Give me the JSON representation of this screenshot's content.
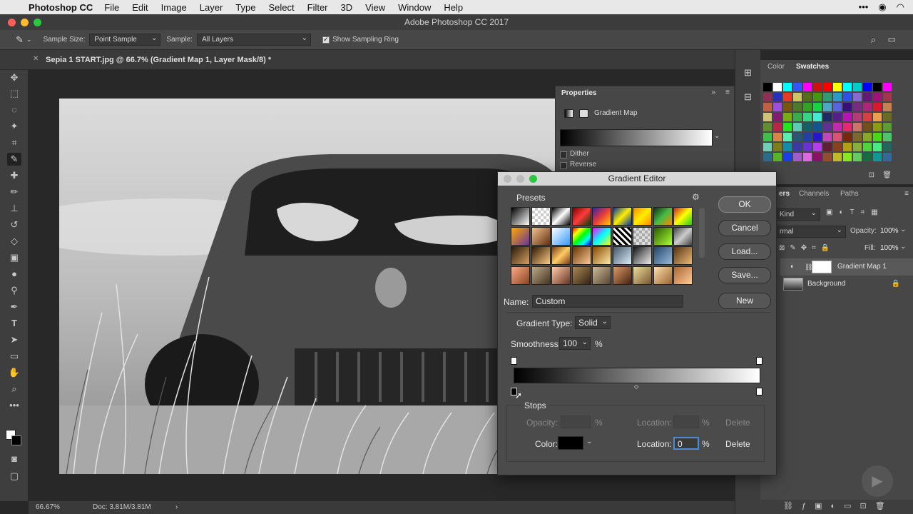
{
  "menubar": {
    "app": "Photoshop CC",
    "items": [
      "File",
      "Edit",
      "Image",
      "Layer",
      "Type",
      "Select",
      "Filter",
      "3D",
      "View",
      "Window",
      "Help"
    ]
  },
  "window": {
    "title": "Adobe Photoshop CC 2017"
  },
  "options": {
    "sample_size_label": "Sample Size:",
    "sample_size_value": "Point Sample",
    "sample_label": "Sample:",
    "sample_value": "All Layers",
    "show_ring_label": "Show Sampling Ring",
    "show_ring_checked": true
  },
  "tab": {
    "title": "Sepia 1 START.jpg @ 66.7% (Gradient Map 1, Layer Mask/8) *"
  },
  "status": {
    "zoom": "66.67%",
    "doc": "Doc: 3.81M/3.81M"
  },
  "properties": {
    "title": "Properties",
    "type": "Gradient Map",
    "dither": "Dither",
    "reverse": "Reverse"
  },
  "swatches_panel": {
    "tabs": [
      "Color",
      "Swatches"
    ],
    "active": "Swatches"
  },
  "layers_panel": {
    "tabs": [
      "ers",
      "Channels",
      "Paths"
    ],
    "kind": "Kind",
    "blend": "rmal",
    "opacity_label": "Opacity:",
    "opacity_value": "100%",
    "fill_label": "Fill:",
    "fill_value": "100%",
    "layers": [
      {
        "name": "Gradient Map 1"
      },
      {
        "name": "Background"
      }
    ]
  },
  "gradient_editor": {
    "title": "Gradient Editor",
    "presets_label": "Presets",
    "buttons": {
      "ok": "OK",
      "cancel": "Cancel",
      "load": "Load...",
      "save": "Save...",
      "new": "New"
    },
    "name_label": "Name:",
    "name_value": "Custom",
    "type_label": "Gradient Type:",
    "type_value": "Solid",
    "smoothness_label": "Smoothness:",
    "smoothness_value": "100",
    "pct": "%",
    "stops_label": "Stops",
    "opacity_label": "Opacity:",
    "location_label": "Location:",
    "delete_label": "Delete",
    "color_label": "Color:",
    "location_value": "0"
  }
}
